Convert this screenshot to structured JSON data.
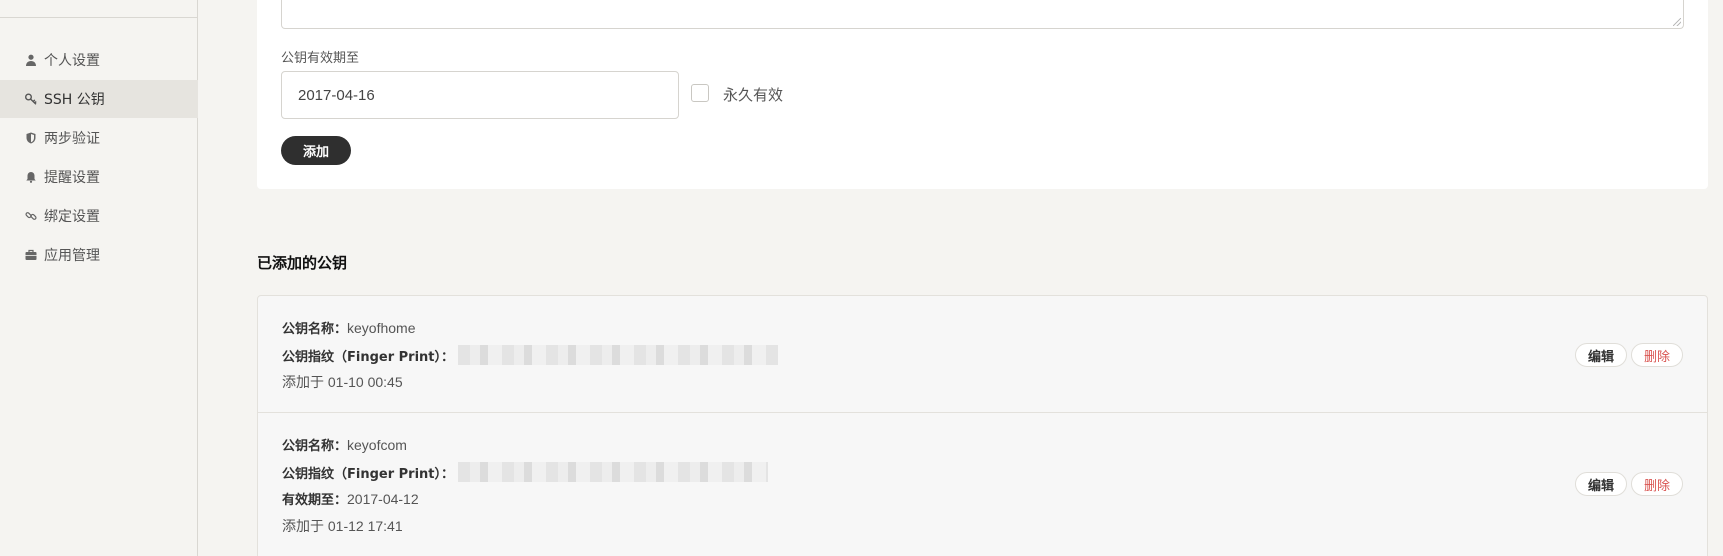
{
  "sidebar": {
    "items": [
      {
        "label": "个人设置",
        "icon": "user-icon",
        "active": false
      },
      {
        "label": "SSH 公钥",
        "icon": "key-icon",
        "active": true
      },
      {
        "label": "两步验证",
        "icon": "shield-icon",
        "active": false
      },
      {
        "label": "提醒设置",
        "icon": "bell-icon",
        "active": false
      },
      {
        "label": "绑定设置",
        "icon": "link-icon",
        "active": false
      },
      {
        "label": "应用管理",
        "icon": "briefcase-icon",
        "active": false
      }
    ]
  },
  "form": {
    "expiry_label": "公钥有效期至",
    "expiry_value": "2017-04-16",
    "permanent_label": "永久有效",
    "add_button": "添加"
  },
  "keys_section": {
    "title": "已添加的公钥",
    "name_label": "公钥名称：",
    "fingerprint_label": "公钥指纹（Finger Print）：",
    "expiry_label": "有效期至：",
    "edit_label": "编辑",
    "delete_label": "删除",
    "keys": [
      {
        "name": "keyofhome",
        "added": "添加于 01-10 00:45"
      },
      {
        "name": "keyofcom",
        "expiry": "2017-04-12",
        "added": "添加于 01-12 17:41"
      }
    ]
  },
  "colors": {
    "dark_button": "#2f2f2f",
    "delete_text": "#d9534f",
    "active_nav": "#e6e4df"
  }
}
